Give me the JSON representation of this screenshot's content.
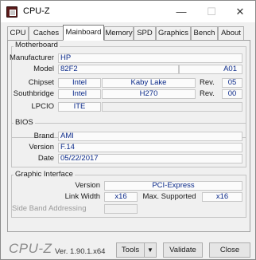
{
  "window": {
    "title": "CPU-Z",
    "minimize": "—",
    "maximize": "☐",
    "close": "✕"
  },
  "tabs": [
    "CPU",
    "Caches",
    "Mainboard",
    "Memory",
    "SPD",
    "Graphics",
    "Bench",
    "About"
  ],
  "motherboard": {
    "section_title": "Motherboard",
    "manufacturer_label": "Manufacturer",
    "manufacturer": "HP",
    "model_label": "Model",
    "model": "82F2",
    "model_rev": "A01",
    "chipset_label": "Chipset",
    "chipset_vendor": "Intel",
    "chipset_name": "Kaby Lake",
    "chipset_rev_label": "Rev.",
    "chipset_rev": "05",
    "southbridge_label": "Southbridge",
    "southbridge_vendor": "Intel",
    "southbridge_name": "H270",
    "southbridge_rev_label": "Rev.",
    "southbridge_rev": "00",
    "lpcio_label": "LPCIO",
    "lpcio_vendor": "ITE"
  },
  "bios": {
    "section_title": "BIOS",
    "brand_label": "Brand",
    "brand": "AMI",
    "version_label": "Version",
    "version": "F.14",
    "date_label": "Date",
    "date": "05/22/2017"
  },
  "graphic_interface": {
    "section_title": "Graphic Interface",
    "version_label": "Version",
    "version": "PCI-Express",
    "link_width_label": "Link Width",
    "link_width": "x16",
    "max_supported_label": "Max. Supported",
    "max_supported": "x16",
    "side_band_label": "Side Band Addressing"
  },
  "footer": {
    "brand": "CPU-Z",
    "version": "Ver. 1.90.1.x64",
    "tools_label": "Tools",
    "tools_arrow": "▼",
    "validate_label": "Validate",
    "close_label": "Close"
  }
}
